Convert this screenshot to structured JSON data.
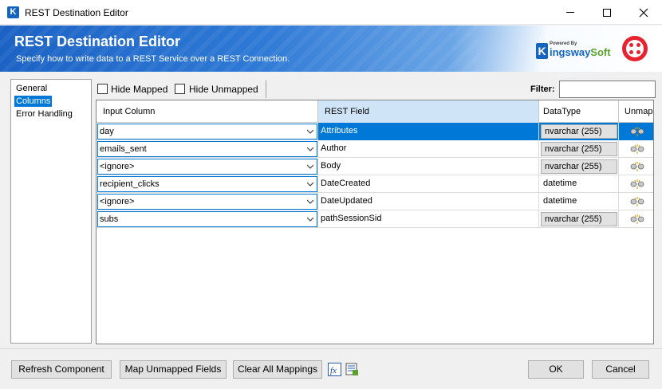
{
  "window": {
    "title": "REST Destination Editor",
    "icon_letter": "K"
  },
  "banner": {
    "title": "REST Destination Editor",
    "subtitle": "Specify how to write data to a REST Service over a REST Connection.",
    "logo_powered": "Powered By",
    "logo_k": "K",
    "logo_name_a": "ingsway",
    "logo_name_b": "Soft"
  },
  "nav": {
    "items": [
      {
        "label": "General",
        "selected": false
      },
      {
        "label": "Columns",
        "selected": true
      },
      {
        "label": "Error Handling",
        "selected": false
      }
    ]
  },
  "toolbar": {
    "hide_mapped": "Hide Mapped",
    "hide_unmapped": "Hide Unmapped",
    "filter_label": "Filter:",
    "filter_value": ""
  },
  "grid": {
    "headers": {
      "input_column": "Input Column",
      "rest_field": "REST Field",
      "data_type": "DataType",
      "unmap": "Unmap"
    },
    "rows": [
      {
        "input": "day",
        "field": "Attributes",
        "type": "nvarchar (255)",
        "boxed": true
      },
      {
        "input": "emails_sent",
        "field": "Author",
        "type": "nvarchar (255)",
        "boxed": true
      },
      {
        "input": "<ignore>",
        "field": "Body",
        "type": "nvarchar (255)",
        "boxed": true
      },
      {
        "input": "recipient_clicks",
        "field": "DateCreated",
        "type": "datetime",
        "boxed": false
      },
      {
        "input": "<ignore>",
        "field": "DateUpdated",
        "type": "datetime",
        "boxed": false
      },
      {
        "input": "subs",
        "field": "pathSessionSid",
        "type": "nvarchar (255)",
        "boxed": true
      }
    ]
  },
  "footer": {
    "refresh": "Refresh Component",
    "map_unmapped": "Map Unmapped Fields",
    "clear_all": "Clear All Mappings",
    "ok": "OK",
    "cancel": "Cancel"
  },
  "colors": {
    "accent": "#0078d7",
    "banner_blue": "#1b62c4",
    "twilio_red": "#e8232f",
    "kingsway_green": "#5aa02c"
  }
}
